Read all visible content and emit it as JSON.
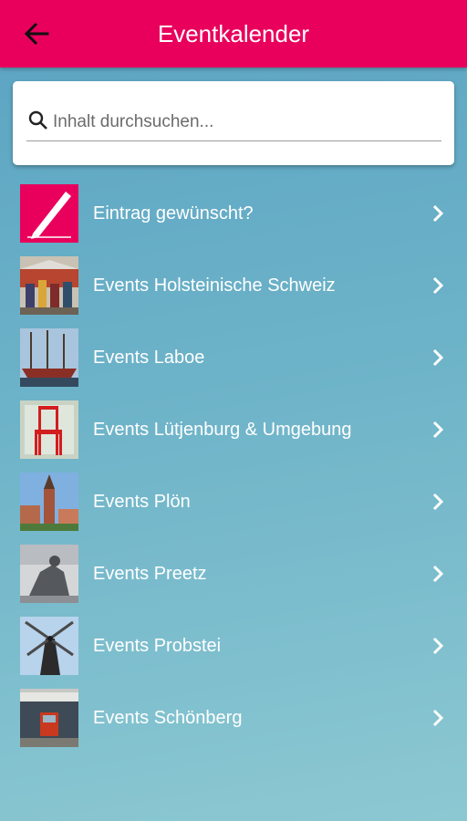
{
  "header": {
    "title": "Eventkalender",
    "back_icon": "arrow-left-icon"
  },
  "search": {
    "placeholder": "Inhalt durchsuchen...",
    "value": "",
    "icon": "search-icon"
  },
  "colors": {
    "appbar": "#e8005c",
    "accent": "#e8005c",
    "text_on_list": "#ffffff"
  },
  "items": [
    {
      "label": "Eintrag gewünscht?",
      "thumb": "pencil-icon"
    },
    {
      "label": "Events Holsteinische Schweiz",
      "thumb": "market-photo"
    },
    {
      "label": "Events Laboe",
      "thumb": "harbor-boats-photo"
    },
    {
      "label": "Events Lütjenburg & Umgebung",
      "thumb": "red-chair-photo"
    },
    {
      "label": "Events Plön",
      "thumb": "church-tower-photo"
    },
    {
      "label": "Events Preetz",
      "thumb": "statue-photo"
    },
    {
      "label": "Events Probstei",
      "thumb": "windmill-photo"
    },
    {
      "label": "Events Schönberg",
      "thumb": "tram-station-photo"
    }
  ]
}
